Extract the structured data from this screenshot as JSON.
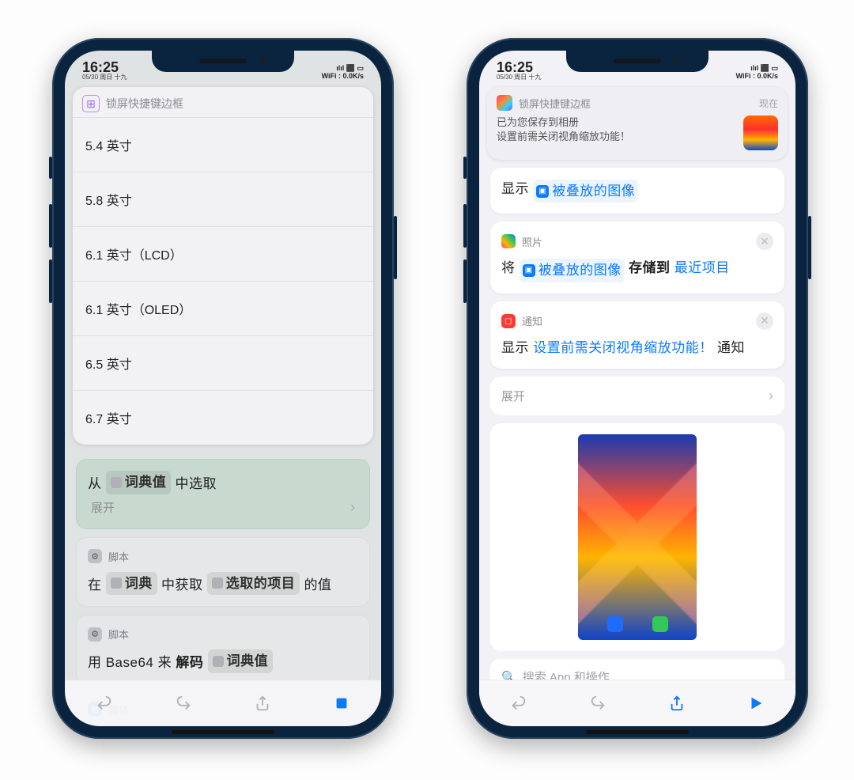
{
  "status": {
    "time": "16:25",
    "date": "05/30 周日 十九",
    "wifi_line": "WiFi : 0.0K/s"
  },
  "left": {
    "header_title": "锁屏快捷键边框",
    "picker": [
      "5.4 英寸",
      "5.8 英寸",
      "6.1 英寸（LCD）",
      "6.1 英寸（OLED）",
      "6.5 英寸",
      "6.7 英寸"
    ],
    "behind": {
      "choose_line_prefix": "从",
      "choose_token": "词典值",
      "choose_line_suffix": "中选取",
      "expand": "展开",
      "script_label": "脚本",
      "get_line_p1": "在",
      "get_tok1": "词典",
      "get_line_p2": "中获取",
      "get_tok2": "选取的项目",
      "get_line_p3": "的值",
      "b64_p1": "用 Base64 来",
      "b64_p2": "解码",
      "b64_tok": "词典值",
      "media_label": "媒体"
    }
  },
  "right": {
    "notif": {
      "app": "锁屏快捷键边框",
      "when": "现在",
      "line1": "已为您保存到相册",
      "line2": "设置前需关闭视角缩放功能！"
    },
    "card_show": {
      "prefix": "显示",
      "token": "被叠放的图像"
    },
    "card_photos": {
      "label": "照片",
      "p1": "将",
      "tok1": "被叠放的图像",
      "p2": "存储到",
      "tok2": "最近项目"
    },
    "card_notify": {
      "label": "通知",
      "prefix": "显示",
      "msg": "设置前需关闭视角缩放功能！",
      "suffix": "通知"
    },
    "expand": "展开",
    "search_placeholder": "搜索 App 和操作"
  }
}
